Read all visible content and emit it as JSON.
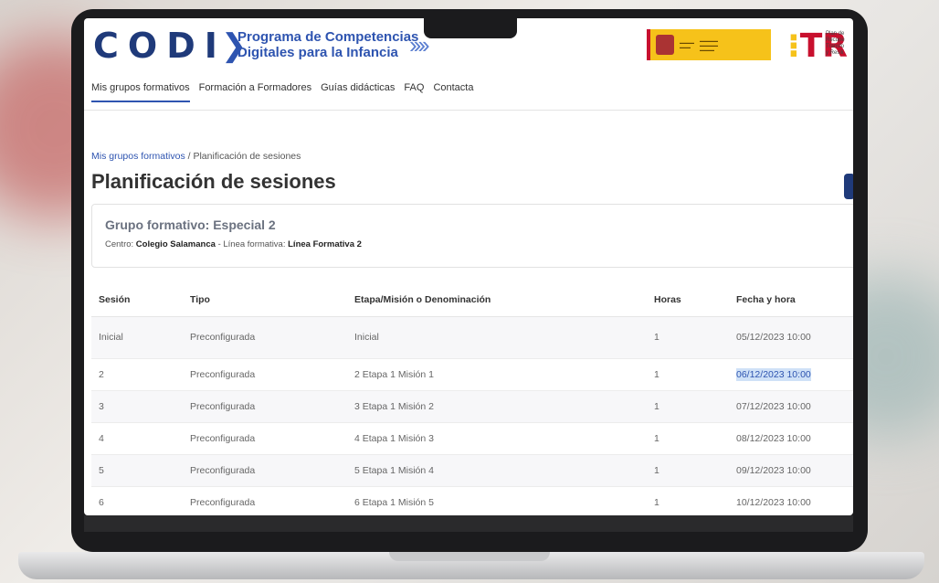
{
  "header": {
    "logo_text": "CODI",
    "program_line1": "Programa de Competencias",
    "program_line2": "Digitales para la Infancia",
    "tr_logo": "TR",
    "plan_lines": [
      "Plan de",
      "Recupe",
      "Transfo",
      "y Resili"
    ]
  },
  "nav": {
    "items": [
      "Mis grupos formativos",
      "Formación a Formadores",
      "Guías didácticas",
      "FAQ",
      "Contacta"
    ]
  },
  "breadcrumb": {
    "root": "Mis grupos formativos",
    "separator": "/",
    "current": "Planificación de sesiones"
  },
  "page": {
    "title": "Planificación de sesiones"
  },
  "group": {
    "title": "Grupo formativo: Especial 2",
    "centro_label": "Centro:",
    "centro_value": "Colegio Salamanca",
    "linea_label": "- Línea formativa:",
    "linea_value": "Línea Formativa 2"
  },
  "table": {
    "headers": [
      "Sesión",
      "Tipo",
      "Etapa/Misión o Denominación",
      "Horas",
      "Fecha y hora"
    ],
    "rows": [
      [
        "Inicial",
        "Preconfigurada",
        "Inicial",
        "1",
        "05/12/2023 10:00"
      ],
      [
        "2",
        "Preconfigurada",
        "2 Etapa 1 Misión 1",
        "1",
        "06/12/2023 10:00"
      ],
      [
        "3",
        "Preconfigurada",
        "3 Etapa 1 Misión 2",
        "1",
        "07/12/2023 10:00"
      ],
      [
        "4",
        "Preconfigurada",
        "4 Etapa 1 Misión 3",
        "1",
        "08/12/2023 10:00"
      ],
      [
        "5",
        "Preconfigurada",
        "5 Etapa 1 Misión 4",
        "1",
        "09/12/2023 10:00"
      ],
      [
        "6",
        "Preconfigurada",
        "6 Etapa 1 Misión 5",
        "1",
        "10/12/2023 10:00"
      ]
    ]
  },
  "colors": {
    "brand_blue": "#2e54b0",
    "brand_dark": "#1f3a7a",
    "gov_yellow": "#f6c21a",
    "tr_red": "#c8102e"
  }
}
